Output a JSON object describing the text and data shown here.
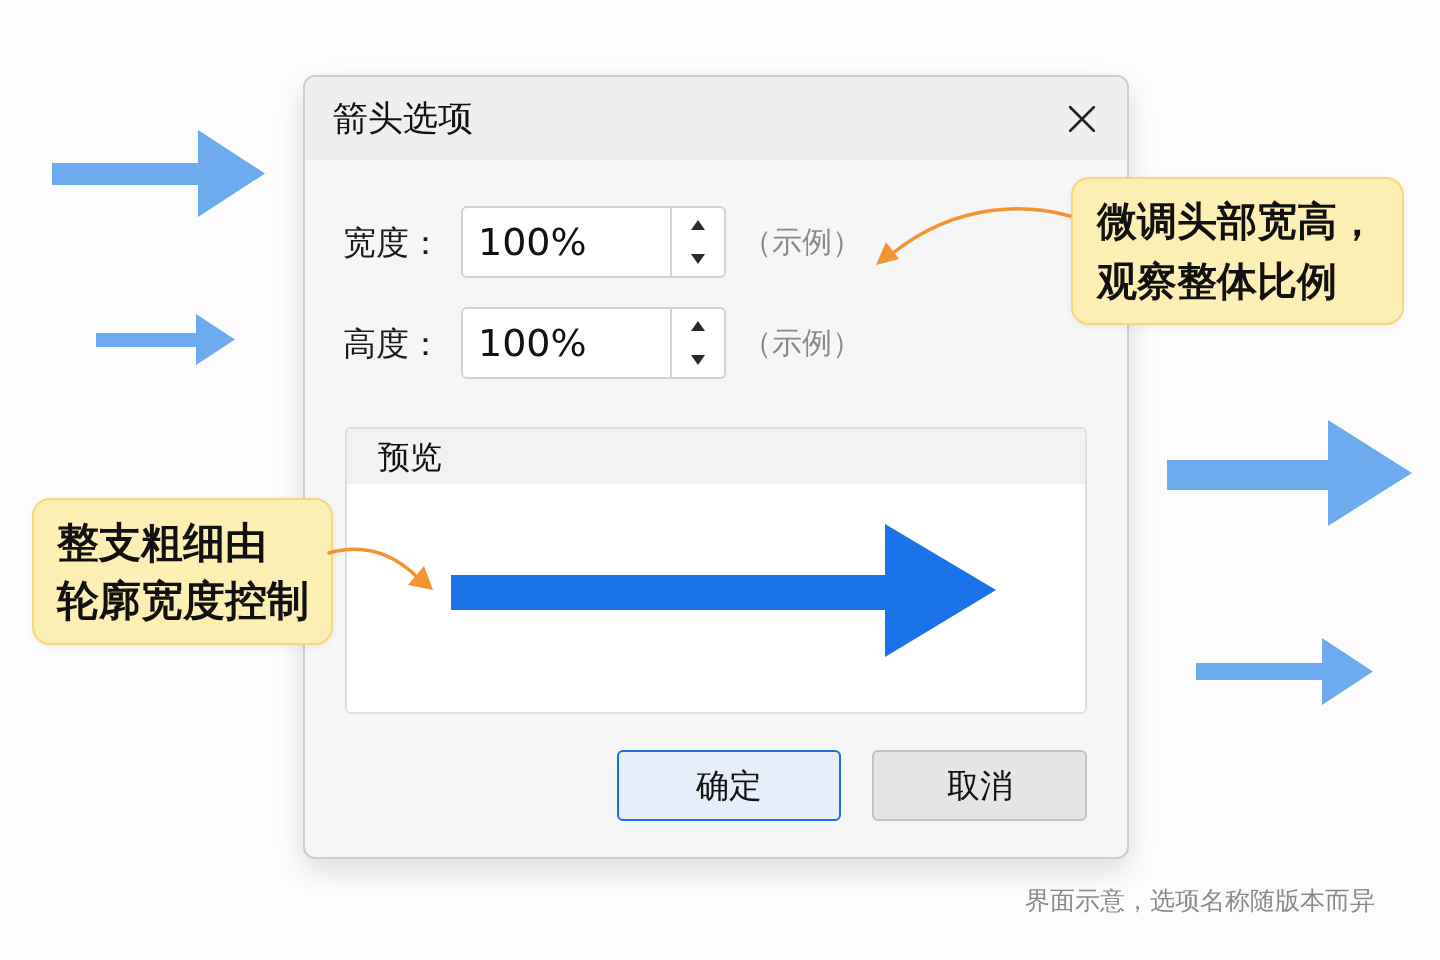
{
  "dialog": {
    "title": "箭头选项",
    "fields": [
      {
        "label": "宽度：",
        "value": "100%",
        "note": "（示例）"
      },
      {
        "label": "高度：",
        "value": "100%",
        "note": "（示例）"
      }
    ],
    "preview": {
      "title": "预览"
    },
    "buttons": [
      {
        "label": "确定",
        "kind": "primary"
      },
      {
        "label": "取消",
        "kind": "secondary"
      }
    ]
  },
  "callouts": [
    {
      "lines": [
        "微调头部宽高，",
        "观察整体比例"
      ]
    },
    {
      "lines": [
        "整支粗细由",
        "轮廓宽度控制"
      ]
    }
  ],
  "caption": "界面示意，选项名称随版本而异"
}
